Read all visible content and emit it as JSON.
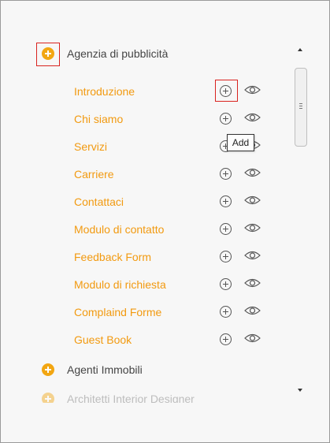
{
  "categories": [
    {
      "label": "Agenzia di pubblicità"
    },
    {
      "label": "Agenti Immobili"
    },
    {
      "label": "Architetti Interior Designer"
    }
  ],
  "pages": [
    {
      "label": "Introduzione"
    },
    {
      "label": "Chi siamo"
    },
    {
      "label": "Servizi"
    },
    {
      "label": "Carriere"
    },
    {
      "label": "Contattaci"
    },
    {
      "label": "Modulo di contatto"
    },
    {
      "label": "Feedback Form"
    },
    {
      "label": "Modulo di richiesta"
    },
    {
      "label": "Complaind Forme"
    },
    {
      "label": "Guest Book"
    }
  ],
  "tooltip": {
    "text": "Add"
  },
  "icons": {
    "category": "plus-circle-icon",
    "add": "plus-circle-icon",
    "preview": "eye-icon"
  },
  "colors": {
    "accent": "#f29a10",
    "category_icon": "#f2a612",
    "highlight": "#d9231f",
    "text": "#444444"
  }
}
